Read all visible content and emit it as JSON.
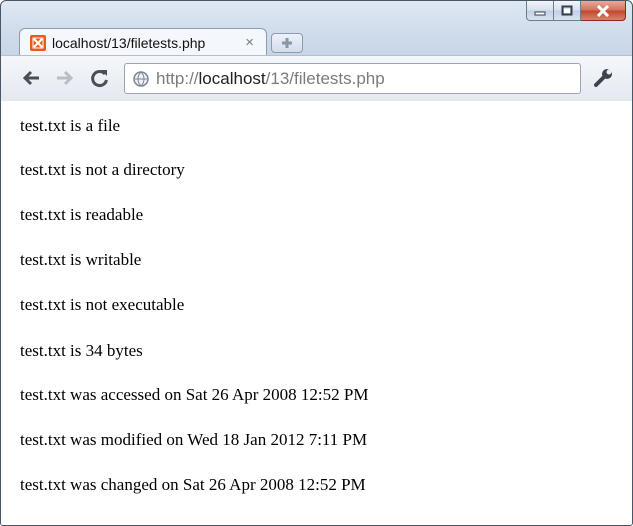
{
  "tab": {
    "title": "localhost/13/filetests.php",
    "close_glyph": "×"
  },
  "address_bar": {
    "scheme": "http://",
    "host": "localhost",
    "path": "/13/filetests.php"
  },
  "icons": [
    "minimize-icon",
    "maximize-icon",
    "close-icon",
    "xampp-favicon-icon",
    "new-tab-icon",
    "back-icon",
    "forward-icon",
    "reload-icon",
    "globe-icon",
    "wrench-icon"
  ],
  "colors": {
    "favicon": "#e8591a",
    "close_button": "#c2452f"
  },
  "page": {
    "lines": [
      "test.txt is a file",
      "test.txt is not a directory",
      "test.txt is readable",
      "test.txt is writable",
      "test.txt is not executable",
      "test.txt is 34 bytes",
      "test.txt was accessed on Sat 26 Apr 2008 12:52 PM",
      "test.txt was modified on Wed 18 Jan 2012 7:11 PM",
      "test.txt was changed on Sat 26 Apr 2008 12:52 PM"
    ]
  }
}
